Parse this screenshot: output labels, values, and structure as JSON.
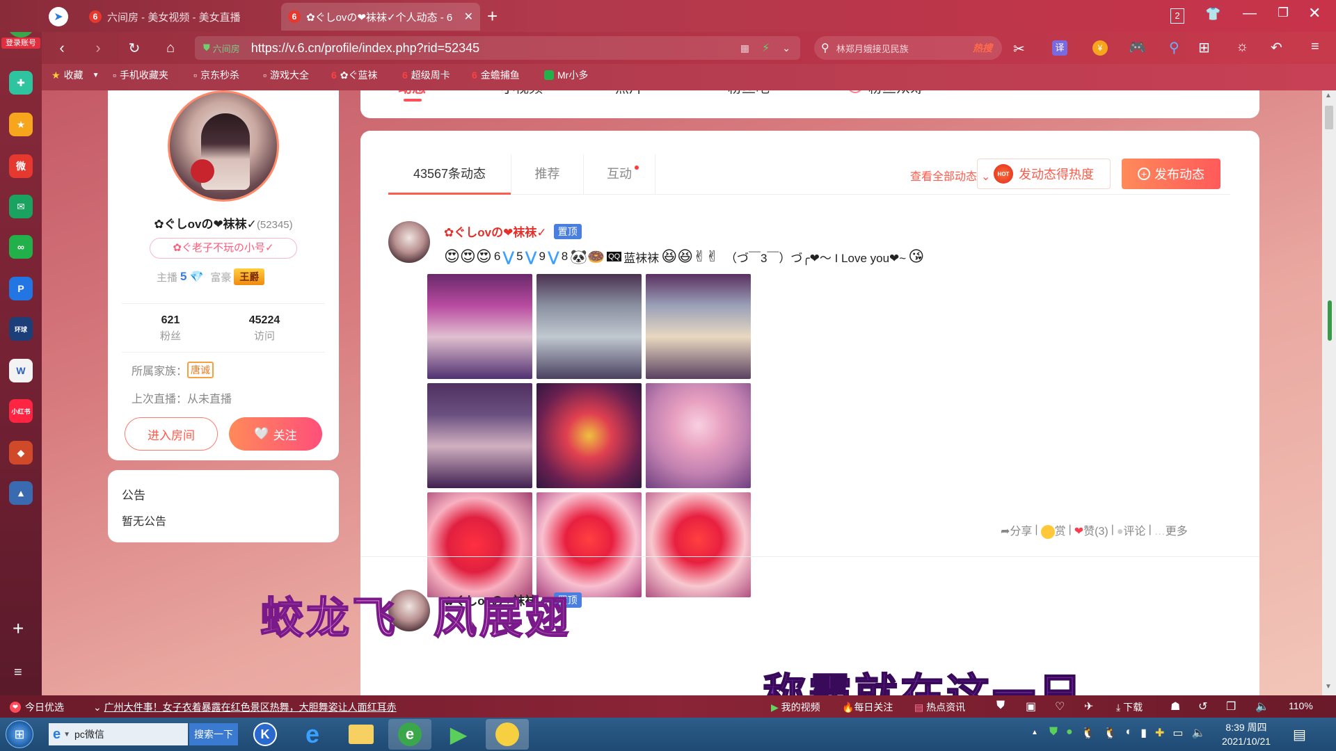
{
  "browser": {
    "login_label": "登录账号",
    "tabs": [
      {
        "label": "六间房 - 美女视频 - 美女直播",
        "favicon": "6"
      },
      {
        "label": "✿ぐしovの❤袜袜✓个人动态 - 6",
        "favicon": "6"
      }
    ],
    "tab_count": "2",
    "url_prefix": "六间房",
    "url": "https://v.6.cn/profile/index.php?rid=52345",
    "search_placeholder": "林郑月娥接见民族",
    "search_hot": "热搜",
    "translate": "译",
    "bookmarks": [
      "收藏",
      "手机收藏夹",
      "京东秒杀",
      "游戏大全",
      "✿ぐ蓝袜",
      "超级周卡",
      "金蟾捕鱼",
      "Mr小多"
    ]
  },
  "profile": {
    "name": "✿ぐしovの❤袜袜✓",
    "rid": "(52345)",
    "badge": "✿ぐ老子不玩の小号✓",
    "anchor_label": "主播",
    "anchor_level": "5",
    "rich_label": "富豪",
    "rich_title": "王爵",
    "fans_count": "621",
    "fans_label": "粉丝",
    "visits_count": "45224",
    "visits_label": "访问",
    "family_label": "所属家族：",
    "family_name": "唐诚",
    "last_live_label": "上次直播：从未直播",
    "enter_room": "进入房间",
    "follow": "关注"
  },
  "notice": {
    "title": "公告",
    "content": "暂无公告"
  },
  "profile_nav": [
    "动态",
    "小视频",
    "照片",
    "粉丝吧",
    "粉丝众筹"
  ],
  "feed": {
    "tabs": [
      "43567条动态",
      "推荐",
      "互动"
    ],
    "view_all": "查看全部动态",
    "hot_button": "发动态得热度",
    "publish_button": "发布动态",
    "post": {
      "author": "✿ぐしovの❤袜袜✓",
      "pin": "置顶",
      "content_nums": [
        "6",
        "5",
        "9",
        "8"
      ],
      "content_tail": "蓝袜袜",
      "content_text": "（づ￣3￣）づ╭❤～ I  Love you❤~",
      "actions": [
        "分享",
        "赏",
        "赞(3)",
        "评论",
        "更多"
      ]
    },
    "post2_author": "✿ぐしovの❤袜袜✓",
    "post2_pin": "置顶"
  },
  "overlay": {
    "line1": "蛟龙飞  凤展翅",
    "line2": "称霸就在这一日"
  },
  "statusbar": {
    "today": "今日优选",
    "news": "广州大件事！女子衣着暴露在红色景区热舞，大胆舞姿让人面红耳赤",
    "items": [
      "我的视频",
      "每日关注",
      "热点资讯"
    ],
    "download": "下载",
    "zoom": "110%"
  },
  "taskbar": {
    "search_text": "pc微信",
    "search_button": "搜索一下",
    "time": "8:39 周四",
    "date": "2021/10/21"
  },
  "colors": {
    "accent": "#ff5a3c",
    "pink": "#ff4f7a",
    "blue_pin": "#4a7fe0"
  }
}
